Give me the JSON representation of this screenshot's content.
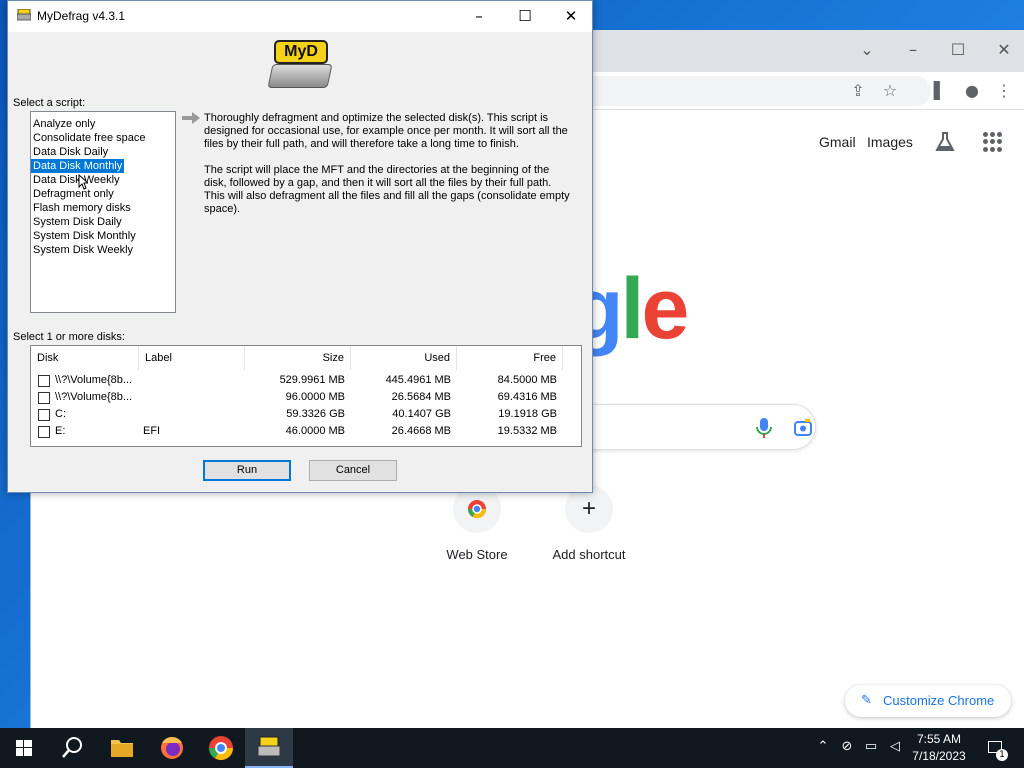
{
  "dialog": {
    "title": "MyDefrag v4.3.1",
    "logo_text": "MyD",
    "script_label": "Select a script:",
    "scripts": [
      "Analyze only",
      "Consolidate free space",
      "Data Disk Daily",
      "Data Disk Monthly",
      "Data Disk Weekly",
      "Defragment only",
      "Flash memory disks",
      "System Disk Daily",
      "System Disk Monthly",
      "System Disk Weekly"
    ],
    "selected_script": "Data Disk Monthly",
    "description_1": "Thoroughly defragment and optimize the selected disk(s). This script is designed for occasional use, for example once per month. It will sort all the files by their full path, and will therefore take a long time to finish.",
    "description_2": "The script will place the MFT and the directories at the beginning of the disk, followed by a gap, and then it will sort all the files by their full path. This will also defragment all the files and fill all the gaps (consolidate empty space).",
    "disk_label": "Select 1 or more disks:",
    "columns": {
      "disk": "Disk",
      "label": "Label",
      "size": "Size",
      "used": "Used",
      "free": "Free"
    },
    "disks": [
      {
        "disk": "\\\\?\\Volume{8b...",
        "label": "",
        "size": "529.9961 MB",
        "used": "445.4961 MB",
        "free": "84.5000 MB",
        "checked": false
      },
      {
        "disk": "\\\\?\\Volume{8b...",
        "label": "",
        "size": "96.0000 MB",
        "used": "26.5684 MB",
        "free": "69.4316 MB",
        "checked": false
      },
      {
        "disk": "C:",
        "label": "",
        "size": "59.3326 GB",
        "used": "40.1407 GB",
        "free": "19.1918 GB",
        "checked": false
      },
      {
        "disk": "E:",
        "label": "EFI",
        "size": "46.0000 MB",
        "used": "26.4668 MB",
        "free": "19.5332 MB",
        "checked": false
      }
    ],
    "run_label": "Run",
    "cancel_label": "Cancel"
  },
  "chrome": {
    "gmail": "Gmail",
    "images": "Images",
    "logo_partial": [
      "g",
      "l",
      "e"
    ],
    "logo_colors": [
      "#34a853",
      "#4285f4",
      "#ea4335"
    ],
    "shortcuts": [
      {
        "label": "Web Store"
      },
      {
        "label": "Add shortcut"
      }
    ],
    "customize": "Customize Chrome"
  },
  "taskbar": {
    "time": "7:55 AM",
    "date": "7/18/2023",
    "notification_count": "1",
    "apps": [
      "start",
      "search",
      "file-explorer",
      "firefox",
      "chrome",
      "mydefrag"
    ]
  }
}
